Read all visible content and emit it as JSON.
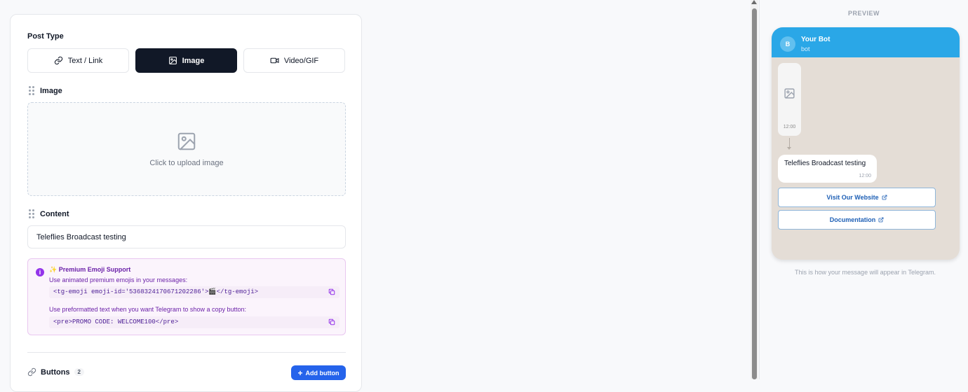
{
  "editor": {
    "post_type_label": "Post Type",
    "post_types": [
      {
        "label": "Text / Link",
        "icon": "link-icon",
        "active": false
      },
      {
        "label": "Image",
        "icon": "image-icon",
        "active": true
      },
      {
        "label": "Video/GIF",
        "icon": "video-icon",
        "active": false
      }
    ],
    "image_section": {
      "title": "Image",
      "upload_text": "Click to upload image"
    },
    "content_section": {
      "title": "Content",
      "value": "Teleflies Broadcast testing"
    },
    "emoji_box": {
      "title": "✨ Premium Emoji Support",
      "line1": "Use animated premium emojis in your messages:",
      "code1": "<tg-emoji emoji-id='5368324170671202286'>🎬</tg-emoji>",
      "line2": "Use preformatted text when you want Telegram to show a copy button:",
      "code2": "<pre>PROMO CODE: WELCOME100</pre>"
    },
    "buttons_section": {
      "title": "Buttons",
      "count": "2",
      "add_label": "Add button"
    }
  },
  "preview": {
    "label": "PREVIEW",
    "bot_initial": "B",
    "bot_name": "Your Bot",
    "bot_sub": "bot",
    "image_time": "12:00",
    "message_text": "Teleflies Broadcast testing",
    "message_time": "12:00",
    "buttons": [
      {
        "label": "Visit Our Website"
      },
      {
        "label": "Documentation"
      }
    ],
    "caption": "This is how your message will appear in Telegram."
  },
  "colors": {
    "accent_dark": "#111827",
    "primary_blue": "#2563eb",
    "telegram_header": "#2aa7e7",
    "chat_background": "#e4ddd6",
    "emoji_purple": "#9333ea"
  }
}
